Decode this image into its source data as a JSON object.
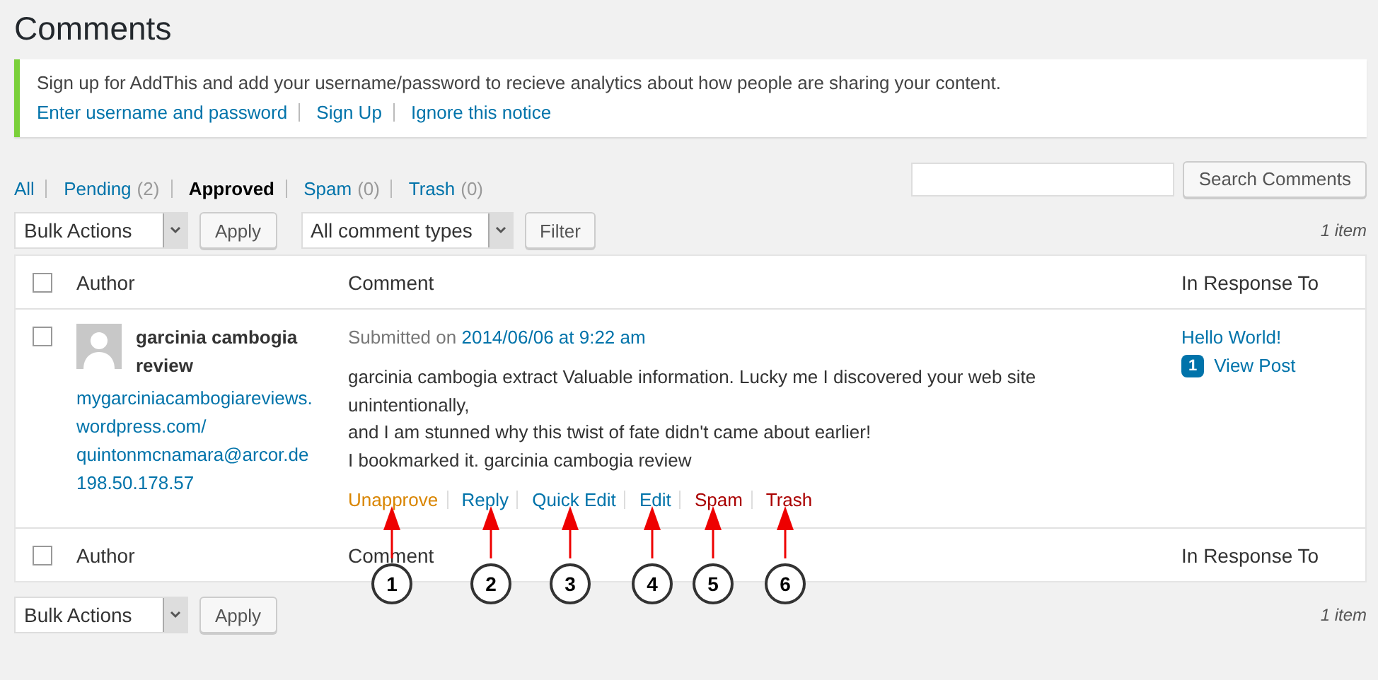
{
  "page_title": "Comments",
  "notice": {
    "message": "Sign up for AddThis and add your username/password to recieve analytics about how people are sharing your content.",
    "links": [
      "Enter username and password",
      "Sign Up",
      "Ignore this notice"
    ]
  },
  "status_filters": [
    {
      "label": "All",
      "selected": false
    },
    {
      "label": "Pending",
      "count": "(2)",
      "selected": false
    },
    {
      "label": "Approved",
      "selected": true
    },
    {
      "label": "Spam",
      "count": "(0)",
      "selected": false
    },
    {
      "label": "Trash",
      "count": "(0)",
      "selected": false
    }
  ],
  "search": {
    "button": "Search Comments"
  },
  "top_toolbar": {
    "bulk_actions": "Bulk Actions",
    "apply": "Apply",
    "type_filter": "All comment types",
    "filter": "Filter",
    "item_count": "1 item"
  },
  "columns": {
    "author": "Author",
    "comment": "Comment",
    "response": "In Response To"
  },
  "footer_columns": {
    "author": "Author",
    "comment": "Comment",
    "response": "In Response To"
  },
  "header_checked": false,
  "rows": [
    {
      "checked": false,
      "author_name": "garcinia cambogia review",
      "author_url": "mygarciniacambogiareviews.wordpress.com/",
      "author_email": "quintonmcnamara@arcor.de",
      "author_ip": "198.50.178.57",
      "submitted_prefix": "Submitted on",
      "submitted_date": "2014/06/06 at 9:22 am",
      "comment_lines": [
        "garcinia cambogia extract Valuable information. Lucky me I discovered your web site unintentionally,",
        "and I am stunned why this twist of fate didn't came about earlier!",
        "I bookmarked it. garcinia cambogia review"
      ],
      "actions": [
        {
          "label": "Unapprove",
          "kind": "approve"
        },
        {
          "label": "Reply",
          "kind": "normal"
        },
        {
          "label": "Quick Edit",
          "kind": "normal"
        },
        {
          "label": "Edit",
          "kind": "normal"
        },
        {
          "label": "Spam",
          "kind": "danger"
        },
        {
          "label": "Trash",
          "kind": "danger"
        }
      ],
      "response_title": "Hello World!",
      "comment_count": "1",
      "view_post": "View Post"
    }
  ],
  "footer_checked": false,
  "bottom_toolbar": {
    "bulk_actions": "Bulk Actions",
    "apply": "Apply",
    "item_count": "1 item"
  },
  "annotations": [
    "1",
    "2",
    "3",
    "4",
    "5",
    "6"
  ]
}
